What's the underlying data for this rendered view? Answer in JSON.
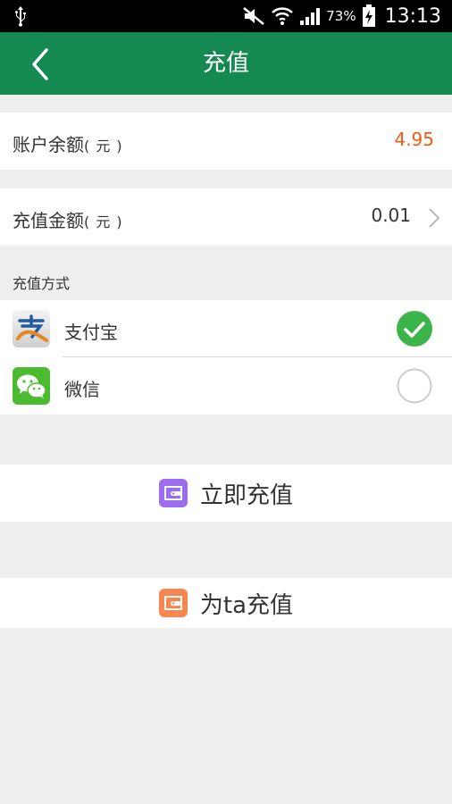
{
  "status_bar": {
    "battery": "73%",
    "time": "13:13"
  },
  "header": {
    "title": "充值"
  },
  "balance": {
    "label": "账户余额",
    "unit": "( 元 )",
    "value": "4.95",
    "value_color": "#f05a12"
  },
  "amount": {
    "label": "充值金额",
    "unit": "( 元 )",
    "value": "0.01"
  },
  "payment": {
    "section_title": "充值方式",
    "methods": [
      {
        "name": "支付宝",
        "icon": "alipay-logo-icon",
        "selected": true
      },
      {
        "name": "微信",
        "icon": "wechat-logo-icon",
        "selected": false
      }
    ]
  },
  "actions": {
    "recharge_label": "立即充值",
    "recharge_icon_color": "#9b6ef0",
    "for_ta_label": "为ta充值",
    "for_ta_icon_color": "#f7874e"
  },
  "colors": {
    "header": "#148a52",
    "check": "#3bb54a"
  }
}
